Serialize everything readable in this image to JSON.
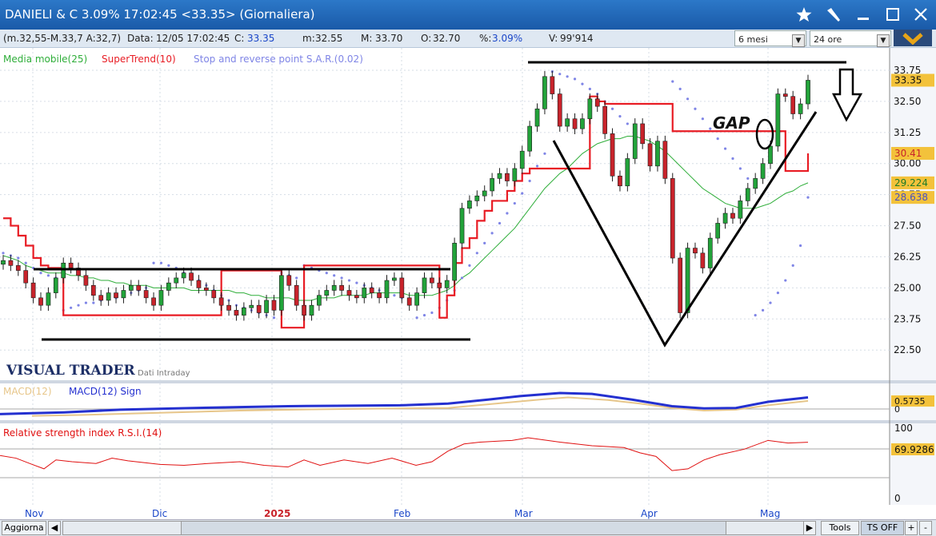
{
  "window": {
    "title": "DANIELI & C 3.09% 17:02:45  <33.35> (Giornaliera)"
  },
  "infobar": {
    "params": "(m.32,55-M.33,7 A:32,7)",
    "data_label": "Data:",
    "data_value": "12/05 17:02:45",
    "c_label": "C:",
    "c_value": "33.35",
    "m_label": "m:",
    "m_value": "32.55",
    "M_label": "M:",
    "M_value": "33.70",
    "o_label": "O:",
    "o_value": "32.70",
    "pct_label": "%:",
    "pct_value": "3.09%",
    "v_label": "V:",
    "v_value": "99'914",
    "period_select": "6 mesi",
    "hours_select": "24 ore"
  },
  "legend": {
    "ma": "Media mobile(25)",
    "supertrend": "SuperTrend(10)",
    "sar": "Stop and reverse point S.A.R.(0.02)"
  },
  "watermark": {
    "brand": "VISUAL TRADER",
    "sub": "Dati Intraday"
  },
  "annotation": {
    "gap": "GAP"
  },
  "macd": {
    "label": "MACD(12)",
    "signal_label": "MACD(12) Sign",
    "value_label": "0.5735",
    "zero_label": "0"
  },
  "rsi": {
    "label": "Relative strength index R.S.I.(14)",
    "top_label": "100",
    "value_label": "69.9286",
    "bottom_label": "0"
  },
  "bottom": {
    "refresh": "Aggiorna",
    "tools": "Tools",
    "ts": "TS OFF",
    "plus": "+",
    "minus": "-"
  },
  "colors": {
    "up": "#22a33a",
    "down": "#c8232b",
    "supertrend": "#e81c24",
    "ma": "#2fae3a",
    "sar": "#7f85e6",
    "macd": "#2430d0",
    "macd_sign": "#e7c68a",
    "rsi": "#e01010"
  },
  "chart_data": {
    "type": "candlestick",
    "title": "DANIELI & C",
    "ylim": [
      21.8,
      34.2
    ],
    "y_ticks": [
      "33.75",
      "32.50",
      "31.25",
      "30.00",
      "28.75",
      "27.50",
      "26.25",
      "25.00",
      "23.75",
      "22.50"
    ],
    "x_months": [
      "Nov",
      "Dic",
      "2025",
      "Feb",
      "Mar",
      "Apr",
      "Mag"
    ],
    "price_labels": {
      "last": "33.35",
      "supertrend": "30.41",
      "ma": "29.224",
      "sar": "28.638"
    },
    "close": [
      26.1,
      25.9,
      25.7,
      25.2,
      24.6,
      24.3,
      24.8,
      25.4,
      26.0,
      25.8,
      25.5,
      25.1,
      24.7,
      24.5,
      24.8,
      24.6,
      24.9,
      25.1,
      24.9,
      24.6,
      24.3,
      24.9,
      25.2,
      25.4,
      25.6,
      25.3,
      25.0,
      24.9,
      24.6,
      24.3,
      24.1,
      23.9,
      24.2,
      24.3,
      24.0,
      24.5,
      24.1,
      25.5,
      25.1,
      24.3,
      23.9,
      24.3,
      24.7,
      24.9,
      25.1,
      24.9,
      24.7,
      24.6,
      25.0,
      24.8,
      24.6,
      25.3,
      25.4,
      24.6,
      24.3,
      24.8,
      25.4,
      25.2,
      25.0,
      25.3,
      26.8,
      28.2,
      28.5,
      28.7,
      28.9,
      29.4,
      29.6,
      29.3,
      29.8,
      30.5,
      31.5,
      32.2,
      33.5,
      32.8,
      31.5,
      31.8,
      31.4,
      31.8,
      32.6,
      32.3,
      31.2,
      29.5,
      29.1,
      30.2,
      31.6,
      30.8,
      29.9,
      30.9,
      29.4,
      26.2,
      24.0,
      26.6,
      26.4,
      25.8,
      27.0,
      27.6,
      28.0,
      27.8,
      28.5,
      29.0,
      29.4,
      30.0,
      30.7,
      32.8,
      32.7,
      32.0,
      32.4,
      33.35
    ],
    "supertrend": [
      27.8,
      27.5,
      27.1,
      26.7,
      26.2,
      25.9,
      25.8,
      25.8,
      23.9,
      23.9,
      23.9,
      23.9,
      23.9,
      23.9,
      23.9,
      23.9,
      23.9,
      23.9,
      23.9,
      23.9,
      23.9,
      23.9,
      23.9,
      23.9,
      23.9,
      23.9,
      23.9,
      23.9,
      23.9,
      25.7,
      25.7,
      25.7,
      25.7,
      25.7,
      25.7,
      25.7,
      25.7,
      23.4,
      23.4,
      23.4,
      25.9,
      25.9,
      25.9,
      25.9,
      25.9,
      25.9,
      25.9,
      25.9,
      25.9,
      25.9,
      25.9,
      25.9,
      25.9,
      25.9,
      25.9,
      25.9,
      25.9,
      25.9,
      23.8,
      24.7,
      26.0,
      26.6,
      27.0,
      27.7,
      28.1,
      28.5,
      28.5,
      28.9,
      29.3,
      29.6,
      29.8,
      29.8,
      29.8,
      29.8,
      29.8,
      29.8,
      29.8,
      29.8,
      32.7,
      32.5,
      32.4,
      32.4,
      32.4,
      32.4,
      32.4,
      32.4,
      32.4,
      32.4,
      32.4,
      31.3,
      31.3,
      31.3,
      31.3,
      31.3,
      31.3,
      31.3,
      31.3,
      31.3,
      31.3,
      31.3,
      31.3,
      31.3,
      31.3,
      31.3,
      29.7,
      29.7,
      29.7,
      30.41
    ],
    "ma": [
      26.3,
      26.2,
      26.1,
      25.9,
      25.8,
      25.7,
      25.6,
      25.6,
      25.6,
      25.5,
      25.5,
      25.4,
      25.4,
      25.3,
      25.3,
      25.2,
      25.2,
      25.1,
      25.1,
      25.1,
      25.0,
      25.0,
      25.0,
      25.0,
      25.0,
      24.9,
      24.9,
      24.9,
      24.9,
      24.9,
      24.9,
      24.8,
      24.8,
      24.7,
      24.7,
      24.6,
      24.6,
      24.6,
      24.6,
      24.5,
      24.5,
      24.5,
      24.6,
      24.6,
      24.6,
      24.7,
      24.7,
      24.7,
      24.7,
      24.8,
      24.8,
      24.8,
      24.8,
      24.8,
      24.7,
      24.7,
      24.7,
      24.7,
      24.8,
      24.9,
      25.1,
      25.4,
      25.6,
      25.9,
      26.2,
      26.5,
      26.8,
      27.1,
      27.4,
      27.8,
      28.2,
      28.6,
      29.0,
      29.3,
      29.6,
      29.8,
      30.1,
      30.4,
      30.6,
      30.8,
      30.9,
      31.0,
      31.0,
      31.1,
      31.1,
      31.0,
      30.9,
      30.7,
      30.5,
      30.2,
      29.9,
      29.6,
      29.3,
      29.0,
      28.8,
      28.6,
      28.4,
      28.3,
      28.2,
      28.2,
      28.2,
      28.3,
      28.4,
      28.6,
      28.8,
      28.9,
      29.1,
      29.224
    ],
    "sar": [
      26.4,
      26.3,
      26.2,
      26.0,
      25.8,
      25.6,
      25.5,
      25.4,
      24.1,
      24.2,
      24.3,
      24.4,
      24.4,
      24.5,
      24.6,
      24.6,
      24.7,
      24.8,
      24.9,
      25.0,
      26.0,
      26.0,
      25.9,
      25.8,
      25.6,
      25.5,
      25.3,
      25.1,
      24.9,
      24.7,
      24.5,
      24.3,
      24.2,
      24.1,
      24.0,
      23.9,
      23.8,
      25.6,
      25.5,
      25.4,
      25.9,
      25.8,
      25.7,
      25.6,
      25.5,
      25.4,
      25.3,
      25.2,
      25.1,
      25.0,
      24.9,
      24.8,
      24.7,
      24.6,
      24.5,
      23.8,
      23.9,
      24.0,
      24.2,
      24.5,
      24.9,
      25.4,
      25.9,
      26.4,
      26.8,
      27.2,
      27.6,
      28.0,
      28.4,
      28.8,
      29.3,
      29.9,
      30.4,
      33.7,
      33.6,
      33.5,
      33.4,
      33.2,
      33.0,
      32.8,
      32.5,
      32.2,
      31.9,
      31.6,
      31.3,
      31.0,
      30.7,
      30.4,
      30.1,
      33.3,
      33.0,
      32.6,
      32.2,
      31.8,
      31.4,
      31.0,
      30.6,
      30.2,
      29.8,
      29.4,
      23.9,
      24.1,
      24.4,
      24.8,
      25.3,
      25.9,
      26.7,
      28.638
    ],
    "macd_series": {
      "name": "MACD(12)",
      "points": [
        [
          0,
          38
        ],
        [
          40,
          36
        ],
        [
          80,
          34
        ],
        [
          150,
          28
        ],
        [
          220,
          25
        ],
        [
          300,
          22
        ],
        [
          360,
          20
        ],
        [
          420,
          19
        ],
        [
          500,
          18
        ],
        [
          560,
          14
        ],
        [
          610,
          5
        ],
        [
          650,
          -3
        ],
        [
          700,
          -10
        ],
        [
          740,
          -8
        ],
        [
          790,
          5
        ],
        [
          840,
          20
        ],
        [
          880,
          25
        ],
        [
          920,
          24
        ],
        [
          960,
          10
        ],
        [
          1000,
          2
        ],
        [
          1010,
          0
        ]
      ]
    },
    "macd_sign_series": {
      "name": "MACD(12) Sign",
      "points": [
        [
          40,
          42
        ],
        [
          100,
          40
        ],
        [
          200,
          35
        ],
        [
          300,
          30
        ],
        [
          400,
          27
        ],
        [
          500,
          25
        ],
        [
          560,
          24
        ],
        [
          620,
          14
        ],
        [
          680,
          4
        ],
        [
          710,
          0
        ],
        [
          760,
          6
        ],
        [
          800,
          14
        ],
        [
          840,
          24
        ],
        [
          880,
          30
        ],
        [
          920,
          28
        ],
        [
          960,
          18
        ],
        [
          1010,
          8
        ]
      ]
    },
    "rsi_series": {
      "name": "Relative strength index R.S.I.(14)",
      "points": [
        [
          0,
          55
        ],
        [
          20,
          52
        ],
        [
          40,
          45
        ],
        [
          55,
          40
        ],
        [
          70,
          50
        ],
        [
          90,
          48
        ],
        [
          120,
          46
        ],
        [
          140,
          52
        ],
        [
          160,
          49
        ],
        [
          200,
          45
        ],
        [
          230,
          44
        ],
        [
          260,
          46
        ],
        [
          300,
          48
        ],
        [
          330,
          44
        ],
        [
          360,
          42
        ],
        [
          380,
          50
        ],
        [
          400,
          44
        ],
        [
          430,
          50
        ],
        [
          460,
          46
        ],
        [
          490,
          52
        ],
        [
          520,
          44
        ],
        [
          540,
          48
        ],
        [
          560,
          60
        ],
        [
          580,
          68
        ],
        [
          600,
          70
        ],
        [
          640,
          72
        ],
        [
          660,
          75
        ],
        [
          700,
          70
        ],
        [
          740,
          66
        ],
        [
          780,
          64
        ],
        [
          800,
          58
        ],
        [
          820,
          54
        ],
        [
          840,
          38
        ],
        [
          860,
          40
        ],
        [
          880,
          50
        ],
        [
          900,
          56
        ],
        [
          930,
          62
        ],
        [
          960,
          72
        ],
        [
          985,
          69
        ],
        [
          1010,
          69.93
        ]
      ]
    }
  }
}
